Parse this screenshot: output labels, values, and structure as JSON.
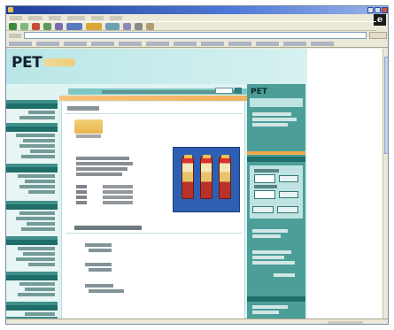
{
  "window": {
    "title": ""
  },
  "menubar": {
    "items": [
      {
        "label": ""
      },
      {
        "label": ""
      },
      {
        "label": ""
      },
      {
        "label": ""
      },
      {
        "label": ""
      },
      {
        "label": ""
      }
    ]
  },
  "toolbar": {
    "icons": [
      "back-icon",
      "forward-icon",
      "stop-icon",
      "refresh-icon",
      "home-icon",
      "search-icon",
      "favorites-icon",
      "history-icon",
      "mail-icon",
      "print-icon",
      "edit-icon"
    ]
  },
  "addressbar": {
    "label": "",
    "url": "",
    "go_label": ""
  },
  "linksbar": {
    "links": [
      {
        "label": ""
      },
      {
        "label": ""
      },
      {
        "label": ""
      },
      {
        "label": ""
      },
      {
        "label": ""
      },
      {
        "label": ""
      },
      {
        "label": ""
      },
      {
        "label": ""
      },
      {
        "label": ""
      },
      {
        "label": ""
      },
      {
        "label": ""
      },
      {
        "label": ""
      }
    ]
  },
  "site": {
    "logo_text": "PET",
    "sidebar_logo_text": "PET",
    "search": {
      "label": "",
      "value": "",
      "button_label": ""
    },
    "breadcrumb": "",
    "badge_caption": "",
    "description_lines": [
      "",
      "",
      "",
      ""
    ],
    "specs": [
      {
        "key": "",
        "value": ""
      },
      {
        "key": "",
        "value": ""
      },
      {
        "key": "",
        "value": ""
      },
      {
        "key": "",
        "value": ""
      }
    ],
    "related_title": "",
    "related_items": [
      {
        "title": "",
        "subtitle": ""
      },
      {
        "title": "",
        "subtitle": ""
      },
      {
        "title": "",
        "subtitle": ""
      }
    ],
    "login": {
      "heading": "",
      "username_label": "",
      "password_label": "",
      "username_value": "",
      "password_value": "",
      "login_button": "",
      "register_button": ""
    }
  },
  "colors": {
    "page_bg": "#dff3f3",
    "nav_teal": "#3f8f8a",
    "nav_head": "#1f6e69",
    "accent_orange": "#f1a94f",
    "product_bg": "#2e5fb3",
    "titlebar": "#1f3f9a"
  }
}
